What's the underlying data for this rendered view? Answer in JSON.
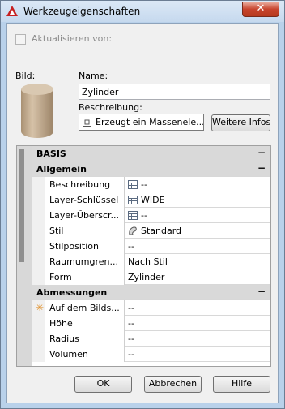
{
  "window": {
    "title": "Werkzeugeigenschaften",
    "close_glyph": "✕"
  },
  "update_checkbox": {
    "label": "Aktualisieren von:",
    "checked": false,
    "enabled": false
  },
  "image": {
    "label": "Bild:",
    "icon": "cylinder-preview"
  },
  "name": {
    "label": "Name:",
    "value": "Zylinder"
  },
  "description": {
    "label": "Beschreibung:",
    "value": "Erzeugt ein Massenele..."
  },
  "more_info_button": "Weitere Infos",
  "property_grid": {
    "sections": [
      {
        "title": "BASIS",
        "collapse_glyph": "−",
        "groups": [
          {
            "title": "Allgemein",
            "collapse_glyph": "−",
            "rows": [
              {
                "label": "Beschreibung",
                "value": "--",
                "icon": "table-icon"
              },
              {
                "label": "Layer-Schlüssel",
                "value": "WIDE",
                "icon": "table-icon"
              },
              {
                "label": "Layer-Überscr...",
                "value": "--",
                "icon": "table-icon"
              },
              {
                "label": "Stil",
                "value": "Standard",
                "icon": "style-icon"
              },
              {
                "label": "Stilposition",
                "value": "--",
                "icon": ""
              },
              {
                "label": "Raumumgren...",
                "value": "Nach Stil",
                "icon": ""
              },
              {
                "label": "Form",
                "value": "Zylinder",
                "icon": ""
              }
            ]
          },
          {
            "title": "Abmessungen",
            "collapse_glyph": "−",
            "rows": [
              {
                "label": "Auf dem Bilds...",
                "value": "--",
                "icon": "",
                "marker": "✳"
              },
              {
                "label": "Höhe",
                "value": "--",
                "icon": ""
              },
              {
                "label": "Radius",
                "value": "--",
                "icon": ""
              },
              {
                "label": "Volumen",
                "value": "--",
                "icon": ""
              }
            ]
          }
        ]
      }
    ]
  },
  "buttons": {
    "ok": "OK",
    "cancel": "Abbrechen",
    "help": "Hilfe"
  },
  "colors": {
    "title_bar": "#c6d9ee",
    "close_button": "#c7432c",
    "cylinder": "#c3ad92",
    "asterisk": "#e08a1c"
  }
}
